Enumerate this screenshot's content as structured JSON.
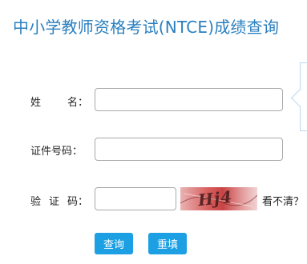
{
  "page": {
    "title": "中小学教师资格考试(NTCE)成绩查询"
  },
  "form": {
    "name_label": [
      "姓",
      "名："
    ],
    "id_label": "证件号码：",
    "code_label": [
      "验",
      "证",
      "码："
    ],
    "name_value": "",
    "id_value": "",
    "code_value": "",
    "captcha_text": "Hj4",
    "refresh_text": "看不清？",
    "query_button": "查询",
    "reset_button": "重填"
  },
  "colors": {
    "title": "#2a7fbf",
    "button": "#1ca0e3",
    "captcha": "#c94444"
  }
}
